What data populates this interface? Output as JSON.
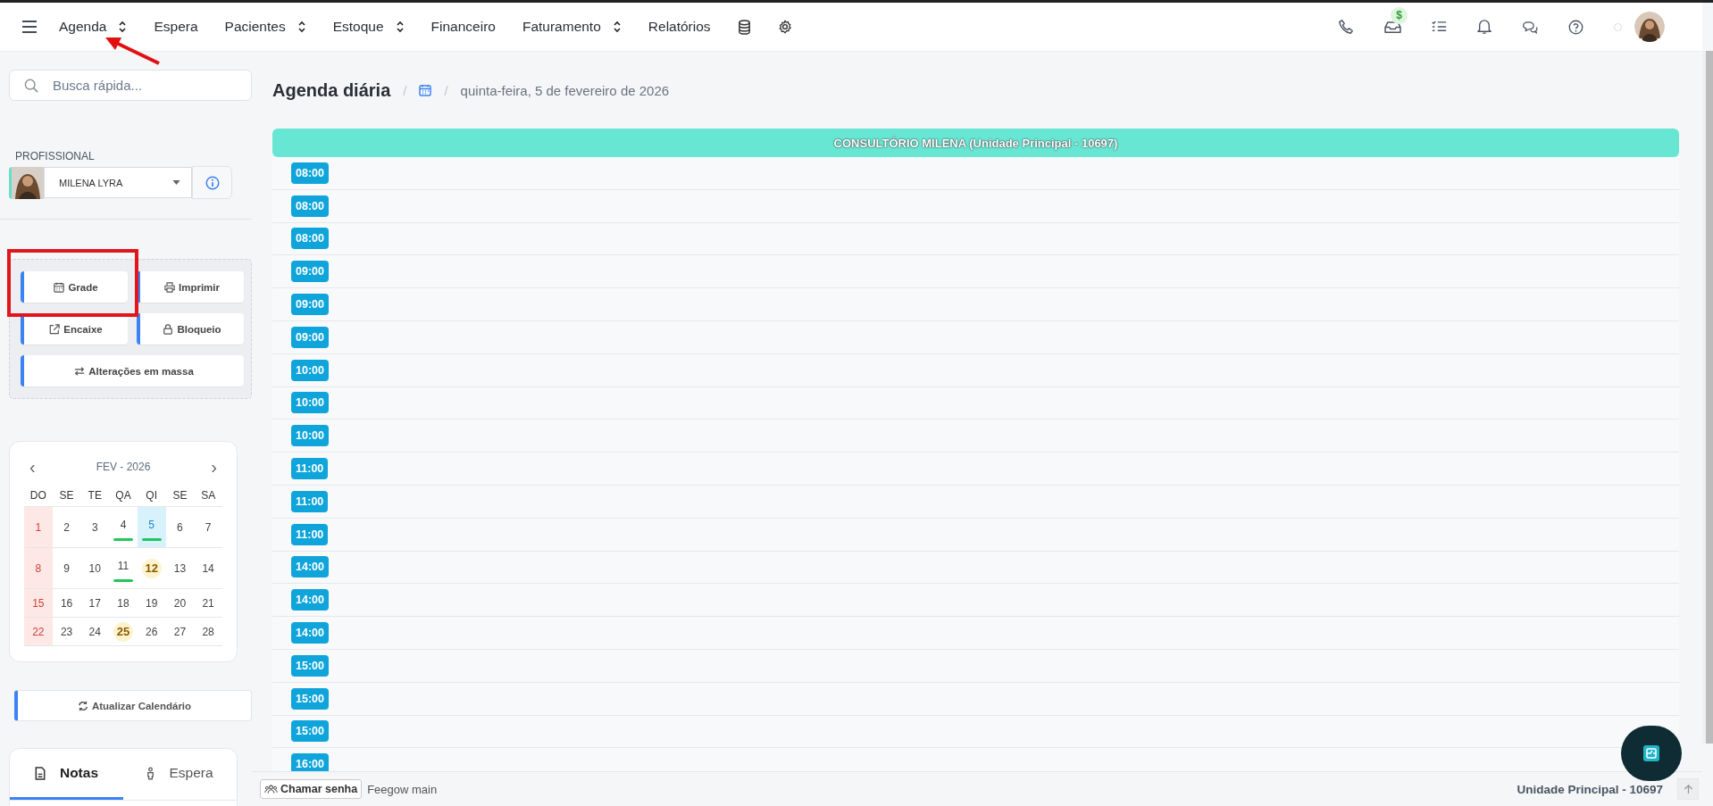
{
  "nav": {
    "items": [
      {
        "label": "Agenda",
        "dropdown": true
      },
      {
        "label": "Espera",
        "dropdown": false
      },
      {
        "label": "Pacientes",
        "dropdown": true
      },
      {
        "label": "Estoque",
        "dropdown": true
      },
      {
        "label": "Financeiro",
        "dropdown": false
      },
      {
        "label": "Faturamento",
        "dropdown": true
      },
      {
        "label": "Relatórios",
        "dropdown": false
      }
    ],
    "badge": "$"
  },
  "sidebar": {
    "search": {
      "placeholder": "Busca rápida..."
    },
    "professional_label": "PROFISSIONAL",
    "professional": "MILENA LYRA",
    "actions": [
      "Grade",
      "Imprimir",
      "Encaixe",
      "Bloqueio",
      "Alterações em massa"
    ],
    "calendar": {
      "title": "FEV - 2026",
      "prev": "‹",
      "next": "›",
      "weekdays": [
        "DO",
        "SE",
        "TE",
        "QA",
        "QI",
        "SE",
        "SA"
      ],
      "weeks": [
        [
          {
            "day": "1",
            "selected": false,
            "marked": false,
            "highlight": false
          },
          {
            "day": "2",
            "selected": false,
            "marked": false,
            "highlight": false
          },
          {
            "day": "3",
            "selected": false,
            "marked": false,
            "highlight": false
          },
          {
            "day": "4",
            "selected": false,
            "marked": true,
            "highlight": false
          },
          {
            "day": "5",
            "selected": true,
            "marked": true,
            "highlight": false
          },
          {
            "day": "6",
            "selected": false,
            "marked": false,
            "highlight": false
          },
          {
            "day": "7",
            "selected": false,
            "marked": false,
            "highlight": false
          }
        ],
        [
          {
            "day": "8",
            "selected": false,
            "marked": false,
            "highlight": false
          },
          {
            "day": "9",
            "selected": false,
            "marked": false,
            "highlight": false
          },
          {
            "day": "10",
            "selected": false,
            "marked": false,
            "highlight": false
          },
          {
            "day": "11",
            "selected": false,
            "marked": true,
            "highlight": false
          },
          {
            "day": "12",
            "selected": false,
            "marked": false,
            "highlight": true
          },
          {
            "day": "13",
            "selected": false,
            "marked": false,
            "highlight": false
          },
          {
            "day": "14",
            "selected": false,
            "marked": false,
            "highlight": false
          }
        ],
        [
          {
            "day": "15",
            "selected": false,
            "marked": false,
            "highlight": false
          },
          {
            "day": "16",
            "selected": false,
            "marked": false,
            "highlight": false
          },
          {
            "day": "17",
            "selected": false,
            "marked": false,
            "highlight": false
          },
          {
            "day": "18",
            "selected": false,
            "marked": false,
            "highlight": false
          },
          {
            "day": "19",
            "selected": false,
            "marked": false,
            "highlight": false
          },
          {
            "day": "20",
            "selected": false,
            "marked": false,
            "highlight": false
          },
          {
            "day": "21",
            "selected": false,
            "marked": false,
            "highlight": false
          }
        ],
        [
          {
            "day": "22",
            "selected": false,
            "marked": false,
            "highlight": false
          },
          {
            "day": "23",
            "selected": false,
            "marked": false,
            "highlight": false
          },
          {
            "day": "24",
            "selected": false,
            "marked": false,
            "highlight": false
          },
          {
            "day": "25",
            "selected": false,
            "marked": false,
            "highlight": true
          },
          {
            "day": "26",
            "selected": false,
            "marked": false,
            "highlight": false
          },
          {
            "day": "27",
            "selected": false,
            "marked": false,
            "highlight": false
          },
          {
            "day": "28",
            "selected": false,
            "marked": false,
            "highlight": false
          }
        ]
      ]
    },
    "refresh_button": "Atualizar Calendário",
    "tabs": [
      {
        "label": "Notas",
        "selected": true
      },
      {
        "label": "Espera",
        "selected": false
      }
    ]
  },
  "main": {
    "title": "Agenda diária",
    "breadcrumb_sep": "/",
    "date": "quinta-feira, 5 de fevereiro de 2026",
    "column_header": "CONSULTÓRIO MILENA (Unidade Principal - 10697)",
    "slots": [
      "08:00",
      "08:00",
      "08:00",
      "09:00",
      "09:00",
      "09:00",
      "10:00",
      "10:00",
      "10:00",
      "11:00",
      "11:00",
      "11:00",
      "14:00",
      "14:00",
      "14:00",
      "15:00",
      "15:00",
      "15:00",
      "16:00"
    ]
  },
  "footer": {
    "call_button": "Chamar senha",
    "app_name": "Feegow main",
    "unit": "Unidade Principal - 10697"
  }
}
